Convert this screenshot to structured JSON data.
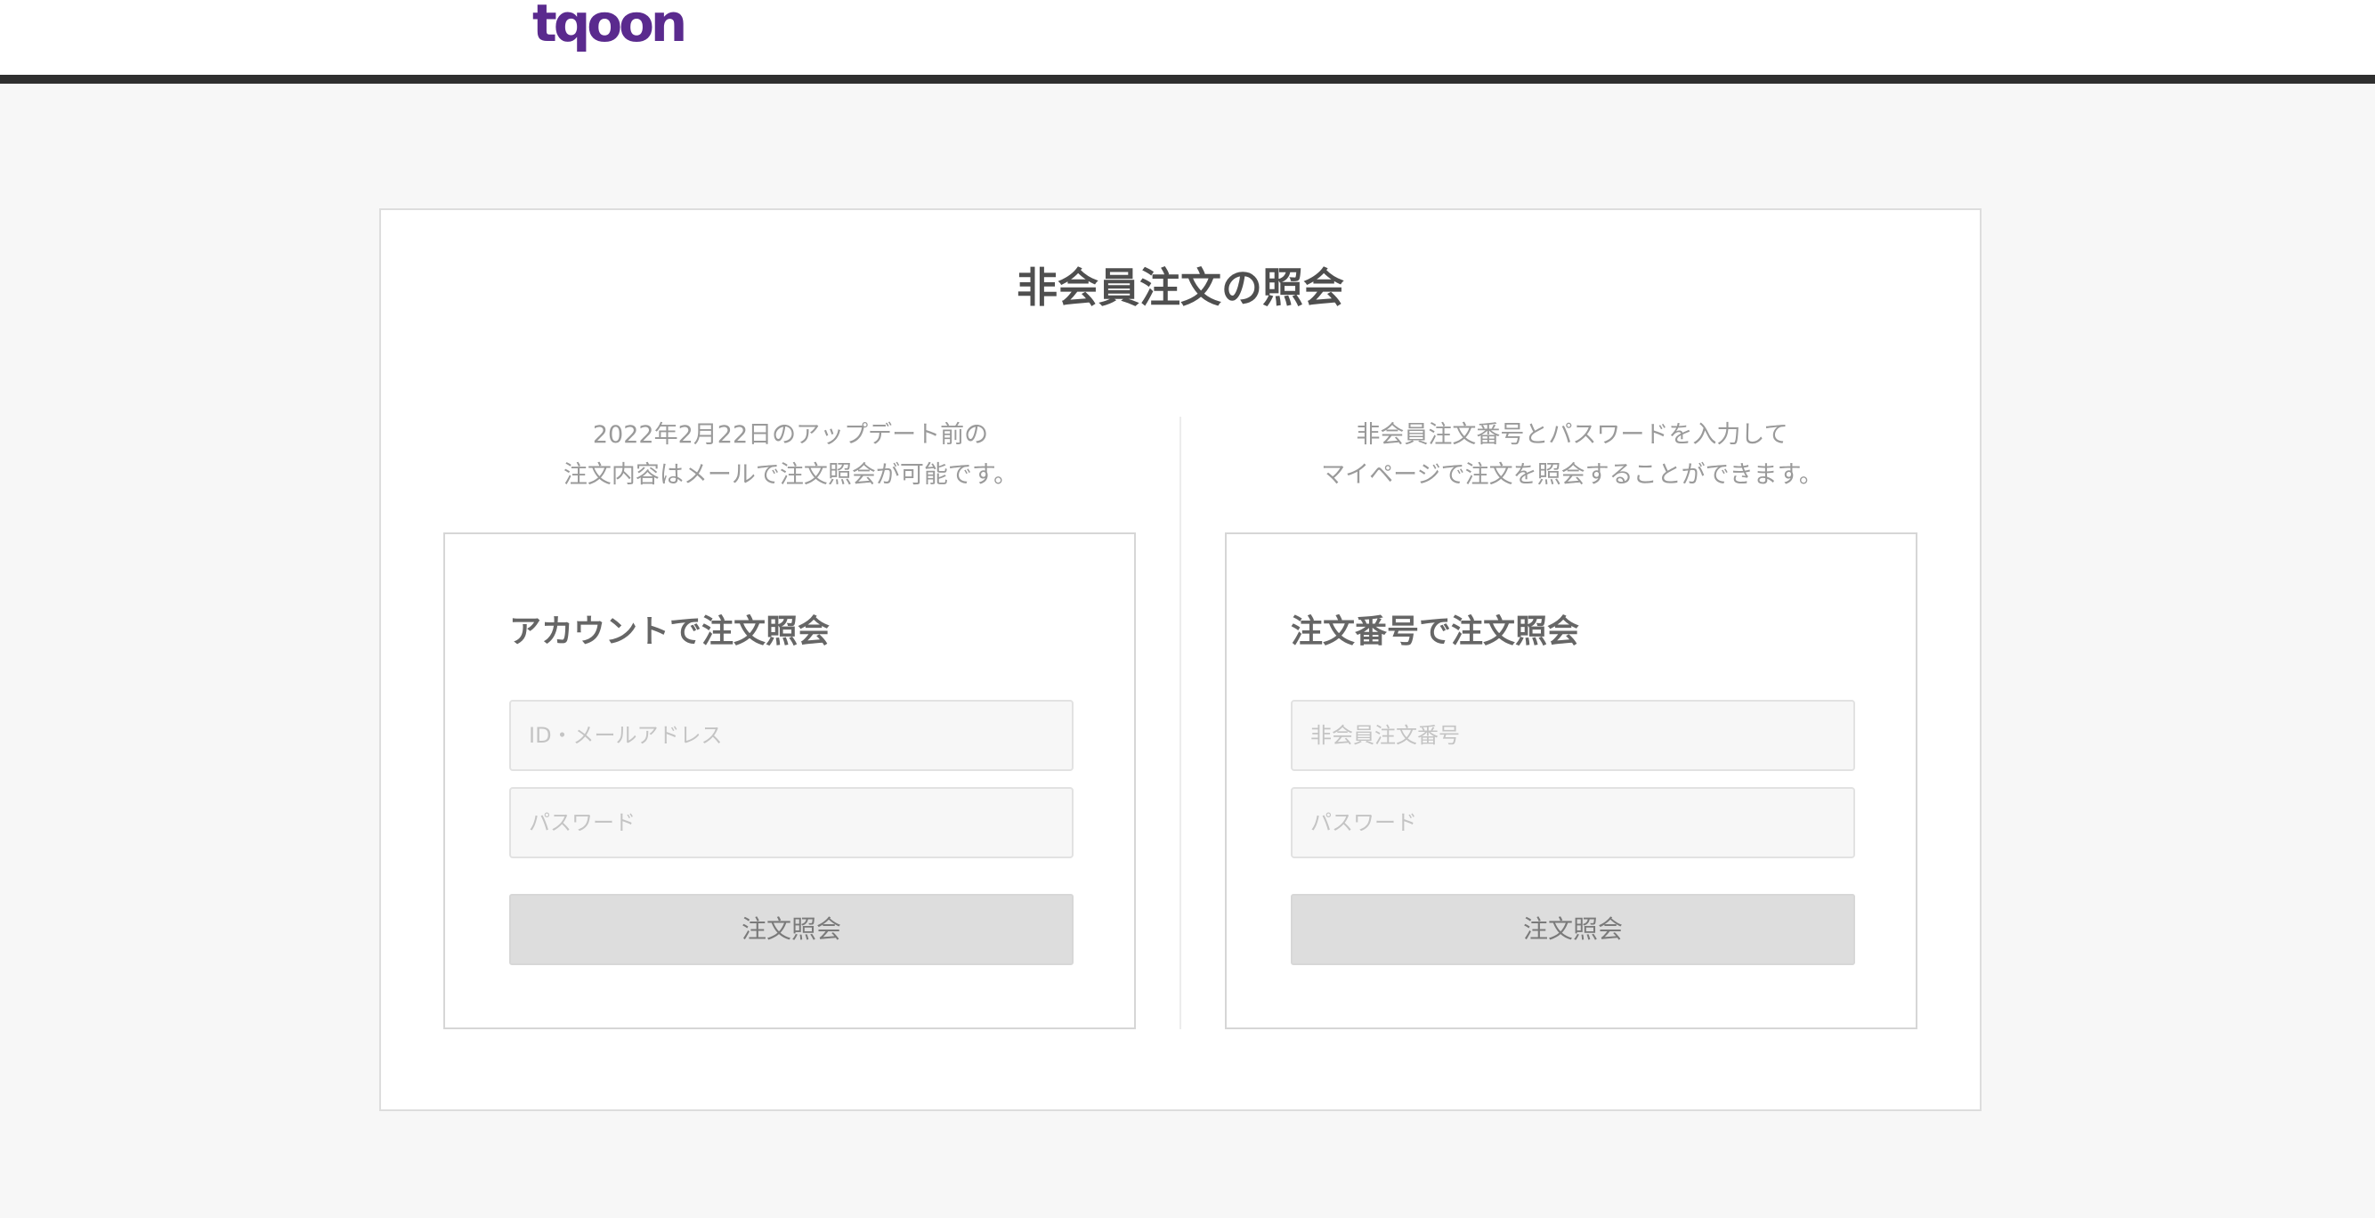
{
  "header": {
    "logo_text": "tqoon"
  },
  "main": {
    "title": "非会員注文の照会",
    "left": {
      "desc_line1": "2022年2月22日のアップデート前の",
      "desc_line2": "注文内容はメールで注文照会が可能です。",
      "box_title": "アカウントで注文照会",
      "id_placeholder": "ID・メールアドレス",
      "password_placeholder": "パスワード",
      "submit_label": "注文照会"
    },
    "right": {
      "desc_line1": "非会員注文番号とパスワードを入力して",
      "desc_line2": "マイページで注文を照会することができます。",
      "box_title": "注文番号で注文照会",
      "order_no_placeholder": "非会員注文番号",
      "password_placeholder": "パスワード",
      "submit_label": "注文照会"
    }
  },
  "colors": {
    "brand": "#5a2a8e",
    "header_rule": "#2f2f2f",
    "background": "#f7f7f7",
    "button_bg": "#dddddd"
  }
}
